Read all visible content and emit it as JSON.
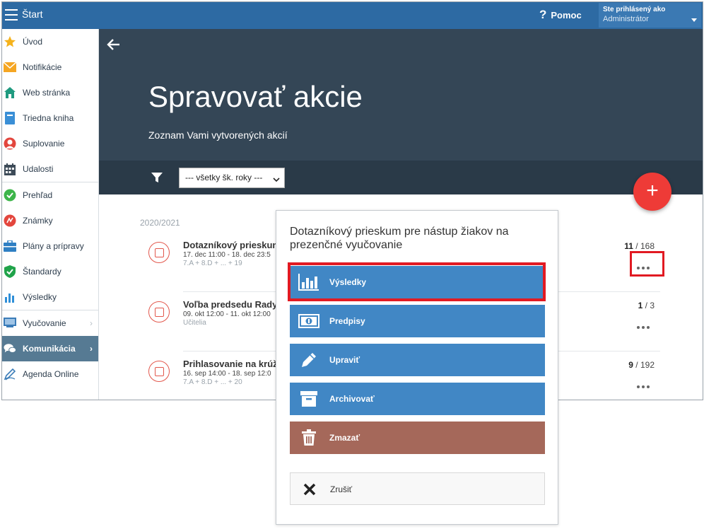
{
  "topbar": {
    "app_title": "Štart",
    "help_label": "Pomoc",
    "user_line1": "Ste prihlásený ako",
    "user_line2": "Administrátor"
  },
  "sidebar": {
    "items": [
      {
        "label": "Úvod",
        "icon": "star-icon"
      },
      {
        "label": "Notifikácie",
        "icon": "envelope-icon"
      },
      {
        "label": "Web stránka",
        "icon": "home-icon"
      },
      {
        "label": "Triedna kniha",
        "icon": "book-icon"
      },
      {
        "label": "Suplovanie",
        "icon": "person-icon"
      },
      {
        "label": "Udalosti",
        "icon": "calendar-icon"
      },
      {
        "label": "Prehľad",
        "icon": "check-circle-icon"
      },
      {
        "label": "Známky",
        "icon": "grade-icon"
      },
      {
        "label": "Plány a prípravy",
        "icon": "briefcase-icon"
      },
      {
        "label": "Štandardy",
        "icon": "shield-check-icon"
      },
      {
        "label": "Výsledky",
        "icon": "bar-chart-icon"
      },
      {
        "label": "Vyučovanie",
        "icon": "teaching-icon"
      },
      {
        "label": "Komunikácia",
        "icon": "chat-icon"
      },
      {
        "label": "Agenda Online",
        "icon": "pen-icon"
      }
    ]
  },
  "header": {
    "title": "Spravovať akcie",
    "subtitle": "Zoznam Vami vytvorených akcií",
    "year_filter_value": "--- všetky šk. roky ---"
  },
  "fab_label": "+",
  "list": {
    "year": "2020/2021",
    "events": [
      {
        "title": "Dotazníkový prieskum",
        "dates": "17. dec 11:00 - 18. dec 23:5",
        "meta": "7.A + 8.D + ... + 19",
        "count_done": "11",
        "count_total": "168"
      },
      {
        "title": "Voľba predsedu Rady",
        "dates": "09. okt 12:00 - 11. okt 12:00",
        "meta": "Učitelia",
        "count_done": "1",
        "count_total": "3"
      },
      {
        "title": "Prihlasovanie na krúž",
        "dates": "16. sep 14:00 - 18. sep 12:0",
        "meta": "7.A + 8.D + ... + 20",
        "count_done": "9",
        "count_total": "192"
      }
    ],
    "count_sep": " / "
  },
  "popup": {
    "title": "Dotazníkový prieskum pre nástup žiakov na prezenčné vyučovanie",
    "buttons": [
      {
        "label": "Výsledky",
        "icon": "bar-chart-icon"
      },
      {
        "label": "Predpisy",
        "icon": "banknote-icon"
      },
      {
        "label": "Upraviť",
        "icon": "pencil-icon"
      },
      {
        "label": "Archivovať",
        "icon": "archive-icon"
      },
      {
        "label": "Zmazať",
        "icon": "trash-icon"
      }
    ],
    "cancel_label": "Zrušiť"
  },
  "colors": {
    "topbar": "#2d6aa3",
    "header": "#344656",
    "action_blue": "#4187c5",
    "delete_brown": "#a5685a",
    "fab_red": "#ee3b37",
    "highlight_red": "#e11a22"
  }
}
